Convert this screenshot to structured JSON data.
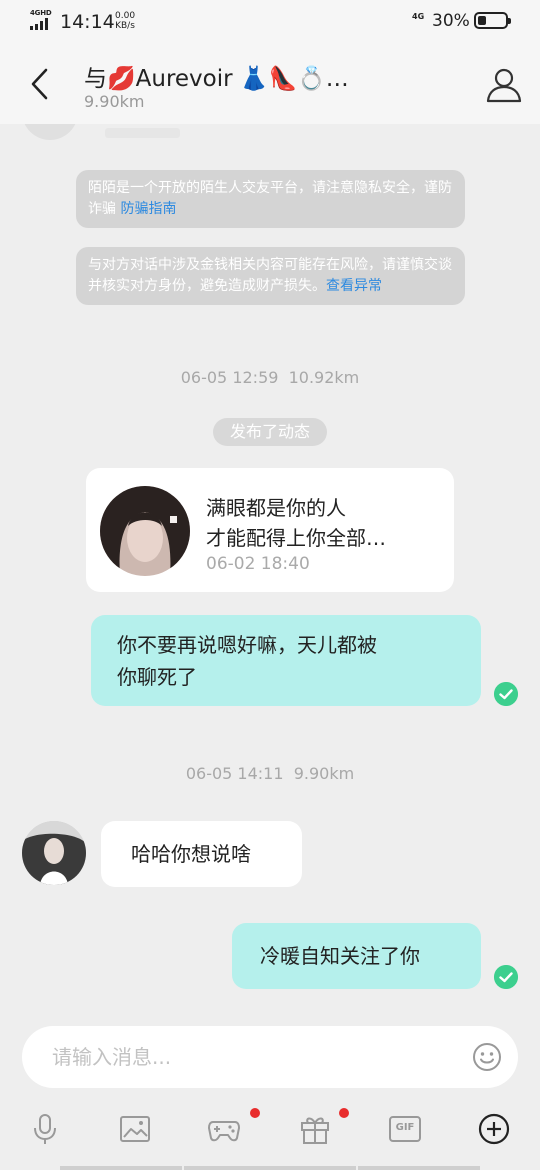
{
  "status_bar": {
    "network": "4GHD",
    "time": "14:14",
    "speed_value": "0.00",
    "speed_unit": "KB/s",
    "mobile": "4G",
    "battery_text": "30%",
    "battery_level": 0.3
  },
  "header": {
    "title": "与💋Aurevoir 👗👠💍…",
    "distance": "9.90km",
    "back_icon": "back-chevron-icon",
    "profile_icon": "user-profile-icon"
  },
  "notices": [
    {
      "text": "陌陌是一个开放的陌生人交友平台，请注意隐私安全，谨防诈骗",
      "link": "防骗指南"
    },
    {
      "text": "与对方对话中涉及金钱相关内容可能存在风险，请谨慎交谈并核实对方身份，避免造成财产损失。",
      "link": "查看异常"
    }
  ],
  "separators": [
    {
      "time": "06-05 12:59",
      "distance": "10.92km"
    },
    {
      "time": "06-05 14:11",
      "distance": "9.90km"
    }
  ],
  "event": {
    "label": "发布了动态"
  },
  "post": {
    "line1": "满眼都是你的人",
    "line2": "才能配得上你全部…",
    "date": "06-02 18:40"
  },
  "messages": [
    {
      "direction": "out",
      "text_line1": "你不要再说嗯好嘛，天儿都被",
      "text_line2": "你聊死了",
      "status": "read"
    },
    {
      "direction": "in",
      "text": "哈哈你想说啥"
    },
    {
      "direction": "out",
      "text": "冷暖自知关注了你",
      "status": "read"
    }
  ],
  "composer": {
    "placeholder": "请输入消息...",
    "emoji_icon": "emoji-icon"
  },
  "toolbar": {
    "items": [
      {
        "icon": "microphone-icon",
        "badge": false
      },
      {
        "icon": "image-icon",
        "badge": false
      },
      {
        "icon": "game-controller-icon",
        "badge": true
      },
      {
        "icon": "gift-icon",
        "badge": true
      },
      {
        "icon": "gif-icon",
        "badge": false,
        "label": "GIF"
      },
      {
        "icon": "plus-circle-icon",
        "badge": false
      }
    ]
  },
  "colors": {
    "outgoing_bubble": "#b5f0ec",
    "incoming_bubble": "#ffffff",
    "read_check": "#3ccf8e",
    "link": "#2d8ae0",
    "badge": "#e82c2c"
  }
}
